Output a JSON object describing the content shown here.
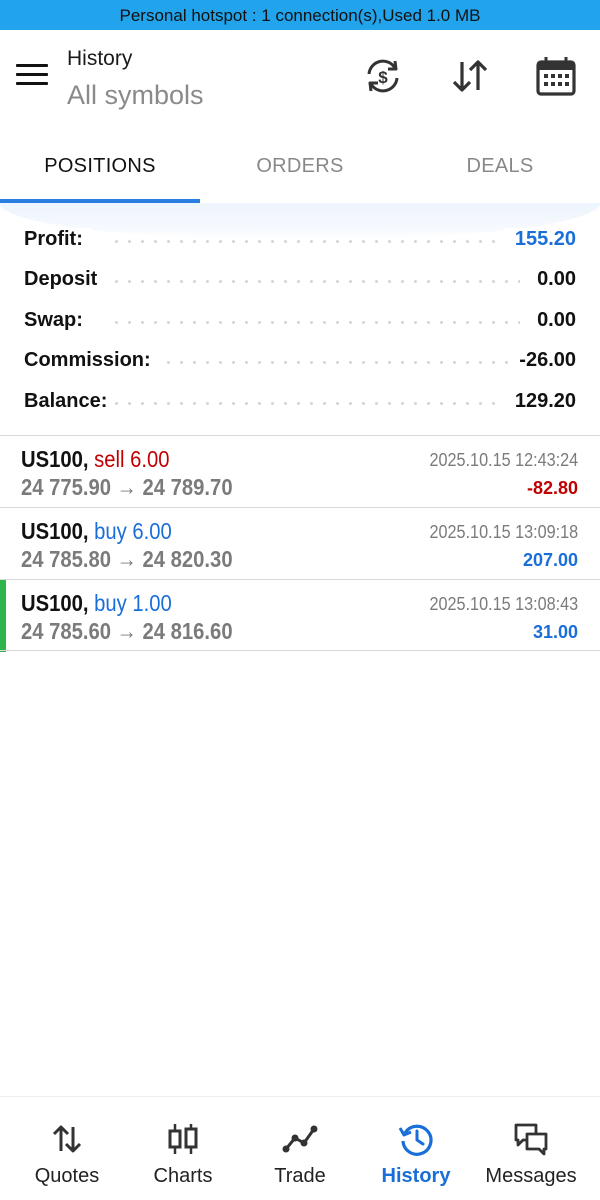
{
  "status_bar": {
    "text": "Personal hotspot : 1 connection(s),Used  1.0 MB"
  },
  "header": {
    "title": "History",
    "subtitle": "All symbols",
    "icons": [
      "currency-exchange-icon",
      "sort-icon",
      "calendar-icon"
    ]
  },
  "tabs": [
    {
      "label": "POSITIONS",
      "active": true
    },
    {
      "label": "ORDERS",
      "active": false
    },
    {
      "label": "DEALS",
      "active": false
    }
  ],
  "summary": [
    {
      "label": "Profit:",
      "value": "155.20",
      "color": "#1a6ed8"
    },
    {
      "label": "Deposit",
      "value": "0.00",
      "color": "#111111"
    },
    {
      "label": "Swap:",
      "value": "0.00",
      "color": "#111111"
    },
    {
      "label": "Commission:",
      "value": "-26.00",
      "color": "#111111"
    },
    {
      "label": "Balance:",
      "value": "129.20",
      "color": "#111111"
    }
  ],
  "trades": [
    {
      "symbol": "US100,",
      "side": "sell 6.00",
      "side_color": "#c00000",
      "prices": "24 775.90 → 24 789.70",
      "time": "2025.10.15 12:43:24",
      "profit": "-82.80",
      "profit_color": "#c00000",
      "selected": false
    },
    {
      "symbol": "US100,",
      "side": "buy 6.00",
      "side_color": "#1a6ed8",
      "prices": "24 785.80 → 24 820.30",
      "time": "2025.10.15 13:09:18",
      "profit": "207.00",
      "profit_color": "#1a6ed8",
      "selected": false
    },
    {
      "symbol": "US100,",
      "side": "buy 1.00",
      "side_color": "#1a6ed8",
      "prices": "24 785.60 → 24 816.60",
      "time": "2025.10.15 13:08:43",
      "profit": "31.00",
      "profit_color": "#1a6ed8",
      "selected": true
    }
  ],
  "bottom_nav": [
    {
      "label": "Quotes",
      "icon": "quotes-arrows-icon",
      "active": false
    },
    {
      "label": "Charts",
      "icon": "candlestick-icon",
      "active": false
    },
    {
      "label": "Trade",
      "icon": "trend-line-icon",
      "active": false
    },
    {
      "label": "History",
      "icon": "history-clock-icon",
      "active": true
    },
    {
      "label": "Messages",
      "icon": "chat-bubbles-icon",
      "active": false
    }
  ],
  "colors": {
    "accent": "#2a7de1",
    "profit_blue": "#1a6ed8",
    "loss_red": "#c00000",
    "selected_marker": "#2db44a",
    "status_bar": "#22a4ec"
  }
}
